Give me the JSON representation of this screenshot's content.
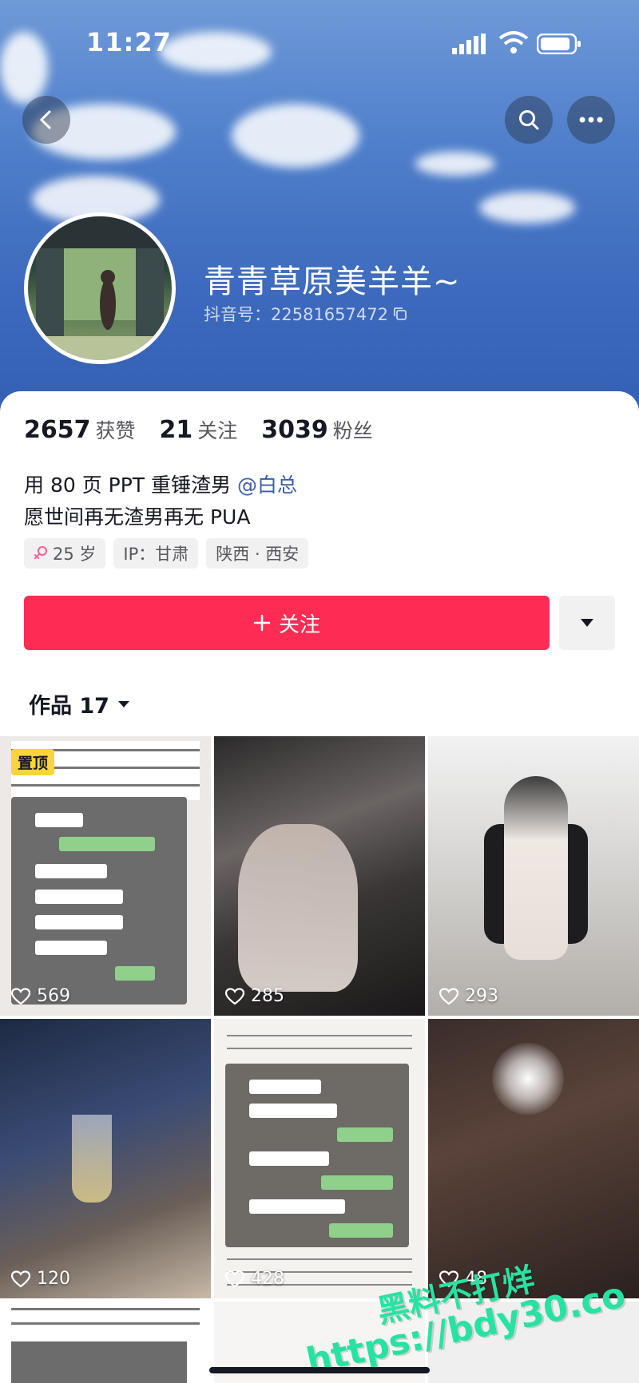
{
  "status_bar": {
    "time": "11:27"
  },
  "profile": {
    "nickname": "青青草原美羊羊~",
    "douyin_id": "抖音号：22581657472",
    "stats": [
      {
        "value": "2657",
        "label": "获赞"
      },
      {
        "value": "21",
        "label": "关注"
      },
      {
        "value": "3039",
        "label": "粉丝"
      }
    ],
    "bio_line1_prefix": "用 80 页 PPT 重锤渣男 ",
    "bio_line1_mention": "@白总",
    "bio_line2": "愿世间再无渣男再无 PUA",
    "tags": {
      "age": "25 岁",
      "ip": "IP：甘肃",
      "location": "陕西 · 西安"
    }
  },
  "actions": {
    "follow_label": "关注",
    "follow_icon": "plus-icon",
    "more_icon": "caret-down-icon"
  },
  "works_tab": {
    "label": "作品 17"
  },
  "grid": [
    {
      "likes": "569",
      "pinned": "置顶"
    },
    {
      "likes": "285"
    },
    {
      "likes": "293"
    },
    {
      "likes": "120"
    },
    {
      "likes": "428"
    },
    {
      "likes": "48"
    }
  ],
  "watermark": {
    "line1": "黑料不打烊",
    "line2": "https://bdy30.co"
  },
  "colors": {
    "follow": "#fe2c55",
    "mention": "#3b5ea8",
    "pin": "#fbd43a",
    "watermark": "#27e3a3"
  }
}
